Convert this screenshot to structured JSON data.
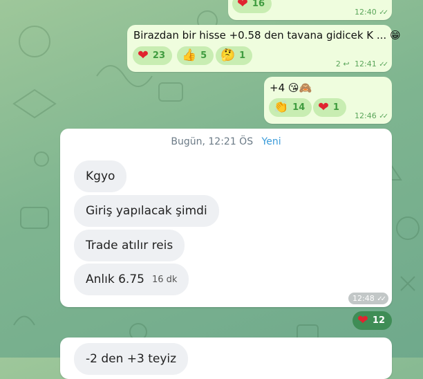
{
  "messages": [
    {
      "reactions": [
        {
          "icon": "heart",
          "count": "16"
        }
      ],
      "time": "12:40"
    },
    {
      "text": "Birazdan bir hisse +0.58 den  tavana gidicek K ... 😁",
      "reactions": [
        {
          "icon": "heart",
          "count": "23"
        },
        {
          "icon": "👍",
          "count": "5"
        },
        {
          "icon": "🤔",
          "count": "1"
        }
      ],
      "replies": "2",
      "time": "12:41"
    },
    {
      "text": "+4 😘🙈",
      "reactions": [
        {
          "icon": "👏",
          "count": "14"
        },
        {
          "icon": "heart",
          "count": "1"
        }
      ],
      "time": "12:46"
    }
  ],
  "forwarded_card": {
    "header_date": "Bugün, 12:21 ÖS",
    "header_link": "Yeni",
    "items": [
      "Kgyo",
      "Giriş yapılacak şimdi",
      "Trade atılır reis",
      "Anlık 6.75"
    ],
    "last_item_age": "16 dk",
    "time": "12:48",
    "reaction": {
      "icon": "heart",
      "count": "12"
    }
  },
  "next_card": {
    "first_item": "-2 den +3 teyiz"
  },
  "colors": {
    "outgoing_bubble": "#effdde",
    "reaction_pill": "#c8edb2",
    "accent_green": "#3f9b3f",
    "link_blue": "#3a9bd9",
    "heart_red": "#e0242f"
  }
}
